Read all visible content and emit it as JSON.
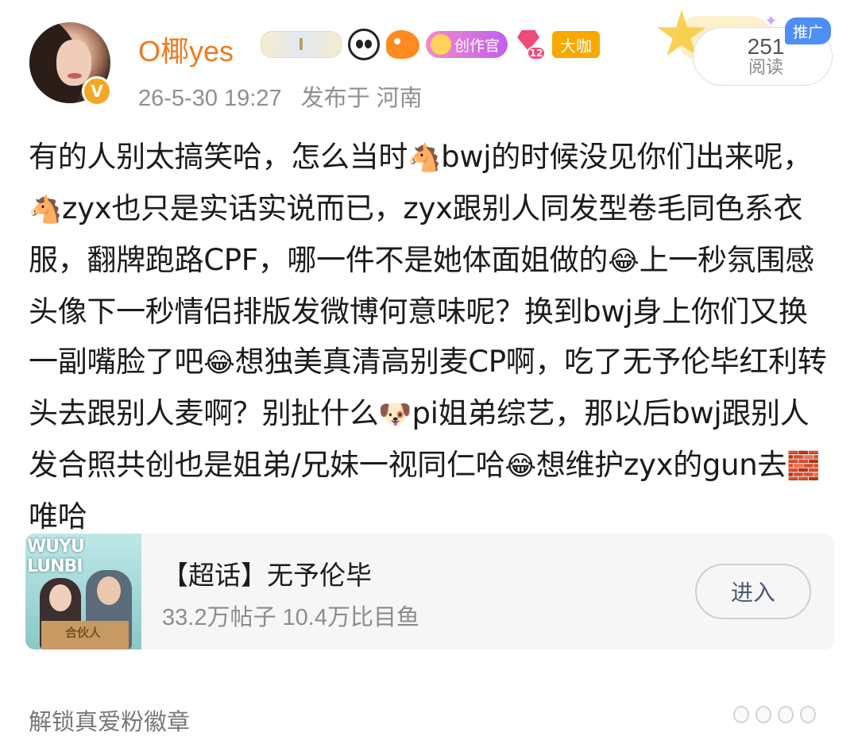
{
  "author": {
    "name": "O椰yes",
    "verified_mark": "V",
    "badges": {
      "level_glyph": "I",
      "creator_label": "创作官",
      "gem_level": "12",
      "vip_label": "大咖"
    }
  },
  "post_meta": {
    "timestamp": "26-5-30 19:27",
    "location": "发布于 河南"
  },
  "stats": {
    "read_count": "251",
    "read_label": "阅读",
    "promo_label": "推广"
  },
  "post_text": {
    "p1": "有的人别太搞笑哈，怎么当时",
    "e1": "🐴",
    "p2": "bwj的时候没见你们出来呢，",
    "e2": "🐴",
    "p3": "zyx也只是实话实说而已，zyx跟别人同发型卷毛同色系衣服，翻牌跑路CPF，哪一件不是她体面姐做的",
    "e3": "😂",
    "p4": "上一秒氛围感头像下一秒情侣排版发微博何意味呢？换到bwj身上你们又换一副嘴脸了吧",
    "e4": "😂",
    "p5": "想独美真清高别麦CP啊，吃了无予伦毕红利转头去跟别人麦啊？别扯什么",
    "e5": "🐶",
    "p6": "pi姐弟综艺，那以后bwj跟别人发合照共创也是姐弟/兄妹一视同仁哈",
    "e6": "😂",
    "p7": "想维护zyx的gun去",
    "e7": "🧱",
    "p8": "唯哈"
  },
  "topic": {
    "thumb_title": "WUYU LUNBI",
    "thumb_logo": "合伙人",
    "name": "【超话】无予伦毕",
    "stats": "33.2万帖子 10.4万比目鱼",
    "enter_label": "进入"
  },
  "footer": {
    "unlock_label": "解锁真爱粉徽章"
  },
  "colors": {
    "username": "#f07a1a",
    "meta": "#8f8f8f",
    "promo": "#4f8ef5",
    "vip": "#f7a900"
  }
}
